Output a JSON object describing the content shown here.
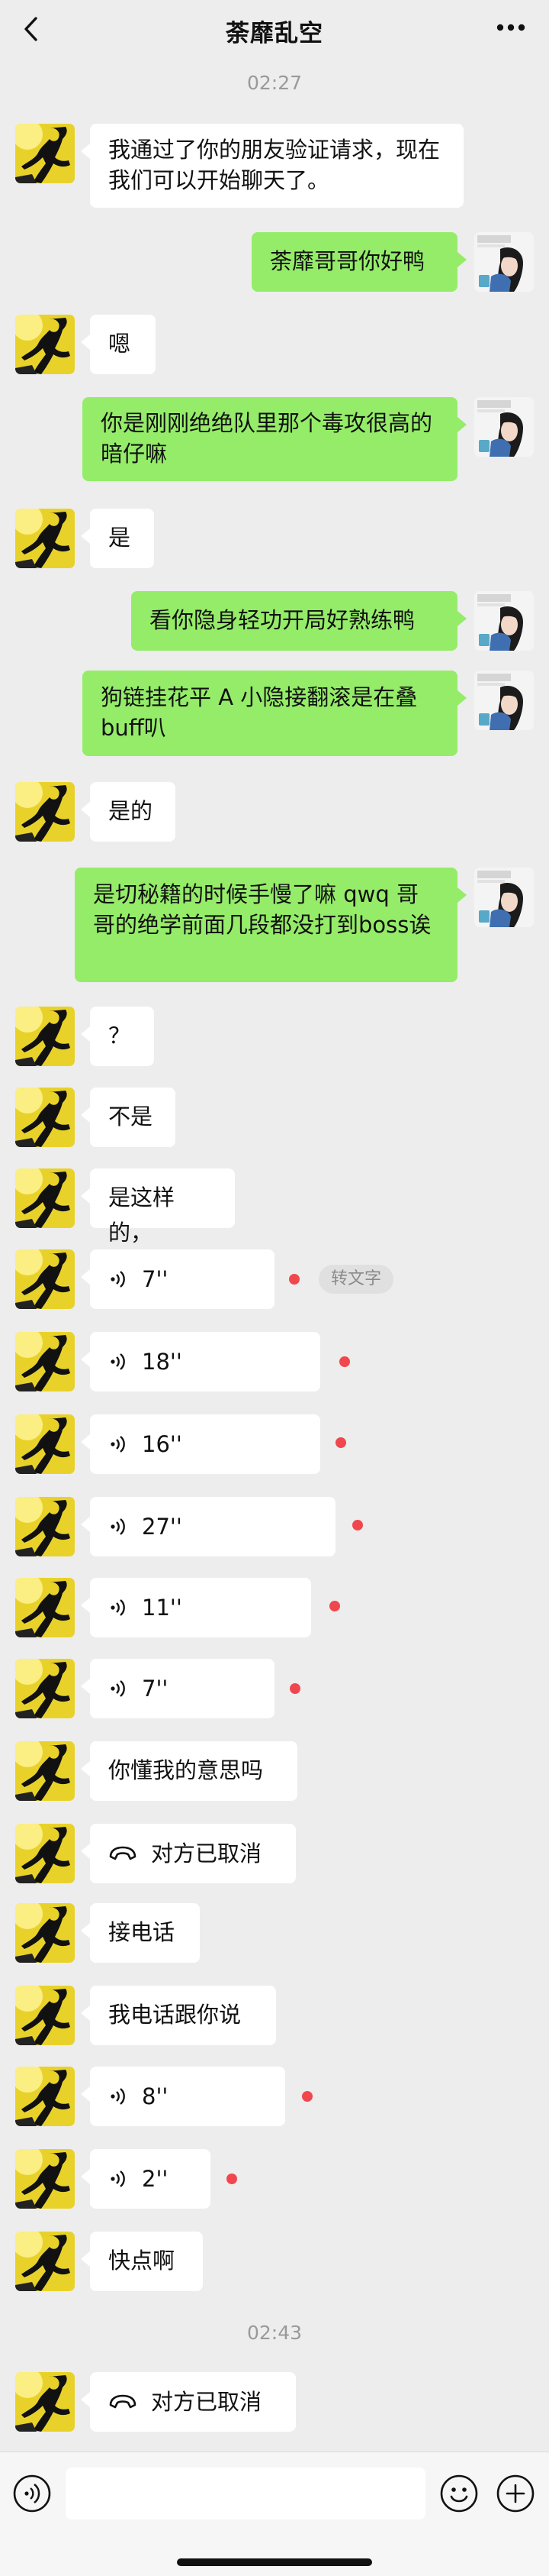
{
  "header": {
    "title": "荼靡乱空"
  },
  "timestamps": {
    "t1": "02:27",
    "t2": "02:43"
  },
  "messages": {
    "m1": "我通过了你的朋友验证请求，现在我们可以开始聊天了。",
    "m2": "荼靡哥哥你好鸭",
    "m3": "嗯",
    "m4": "你是刚刚绝绝队里那个毒攻很高的暗仔嘛",
    "m5": "是",
    "m6": "看你隐身轻功开局好熟练鸭",
    "m7": "狗链挂花平 A 小隐接翻滚是在叠buff叭",
    "m8": "是的",
    "m9": "是切秘籍的时候手慢了嘛 qwq 哥哥的绝学前面几段都没打到boss诶",
    "m10": "？",
    "m11": "不是",
    "m12": "是这样的，",
    "v1": "7''",
    "transcribe": "转文字",
    "v2": "18''",
    "v3": "16''",
    "v4": "27''",
    "v5": "11''",
    "v6": "7''",
    "m13": "你懂我的意思吗",
    "c1": "对方已取消",
    "m14": "接电话",
    "m15": "我电话跟你说",
    "v7": "8''",
    "v8": "2''",
    "m16": "快点啊",
    "c2": "对方已取消"
  },
  "colors": {
    "incoming": "#ffffff",
    "outgoing": "#95ec69",
    "unread_dot": "#f0474e",
    "background": "#ededed"
  },
  "icons": {
    "back": "chevron-left-icon",
    "more": "more-dots-icon",
    "voice": "voice-wave-icon",
    "call": "phone-hangup-icon",
    "input_voice": "voice-input-icon",
    "emoji": "emoji-icon",
    "plus": "plus-icon"
  }
}
